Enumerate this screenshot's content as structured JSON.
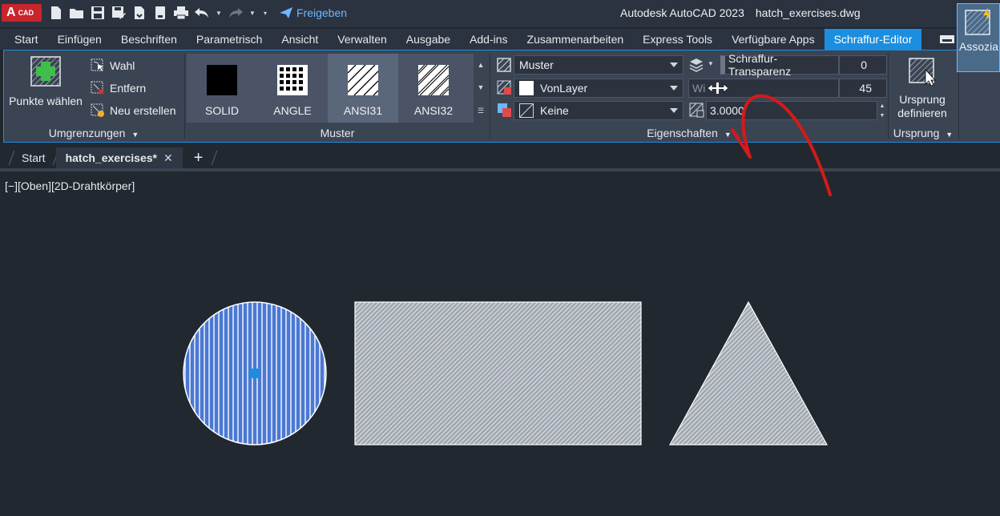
{
  "app": {
    "logo_big": "A",
    "logo_small": "CAD",
    "share_label": "Freigeben",
    "title": "Autodesk AutoCAD 2023",
    "filename": "hatch_exercises.dwg"
  },
  "ribbon_tabs": [
    {
      "label": "Start"
    },
    {
      "label": "Einfügen"
    },
    {
      "label": "Beschriften"
    },
    {
      "label": "Parametrisch"
    },
    {
      "label": "Ansicht"
    },
    {
      "label": "Verwalten"
    },
    {
      "label": "Ausgabe"
    },
    {
      "label": "Add-ins"
    },
    {
      "label": "Zusammenarbeiten"
    },
    {
      "label": "Express Tools"
    },
    {
      "label": "Verfügbare Apps"
    },
    {
      "label": "Schraffur-Editor",
      "active": true
    }
  ],
  "boundaries": {
    "pick_points": "Punkte wählen",
    "select": "Wahl",
    "remove": "Entfern",
    "recreate": "Neu erstellen",
    "title": "Umgrenzungen"
  },
  "patterns": {
    "items": [
      {
        "label": "SOLID"
      },
      {
        "label": "ANGLE"
      },
      {
        "label": "ANSI31",
        "selected": true
      },
      {
        "label": "ANSI32"
      }
    ],
    "title": "Muster"
  },
  "properties": {
    "type": "Muster",
    "color": "VonLayer",
    "background": "Keine",
    "transparency_label": "Schraffur-Transparenz",
    "transparency_value": "0",
    "angle_label": "Wi",
    "angle_value": "45",
    "scale_value": "3.0000",
    "title": "Eigenschaften"
  },
  "origin": {
    "set_label_1": "Ursprung",
    "set_label_2": "definieren",
    "title": "Ursprung"
  },
  "associative": {
    "label": "Assozia"
  },
  "file_tabs": {
    "start": "Start",
    "current": "hatch_exercises*"
  },
  "viewport": {
    "label": "[−][Oben][2D-Drahtkörper]"
  },
  "colors": {
    "accent": "#1c8ee0",
    "annotation": "#d41a1a",
    "selected_hatch": "#4a78d4"
  }
}
